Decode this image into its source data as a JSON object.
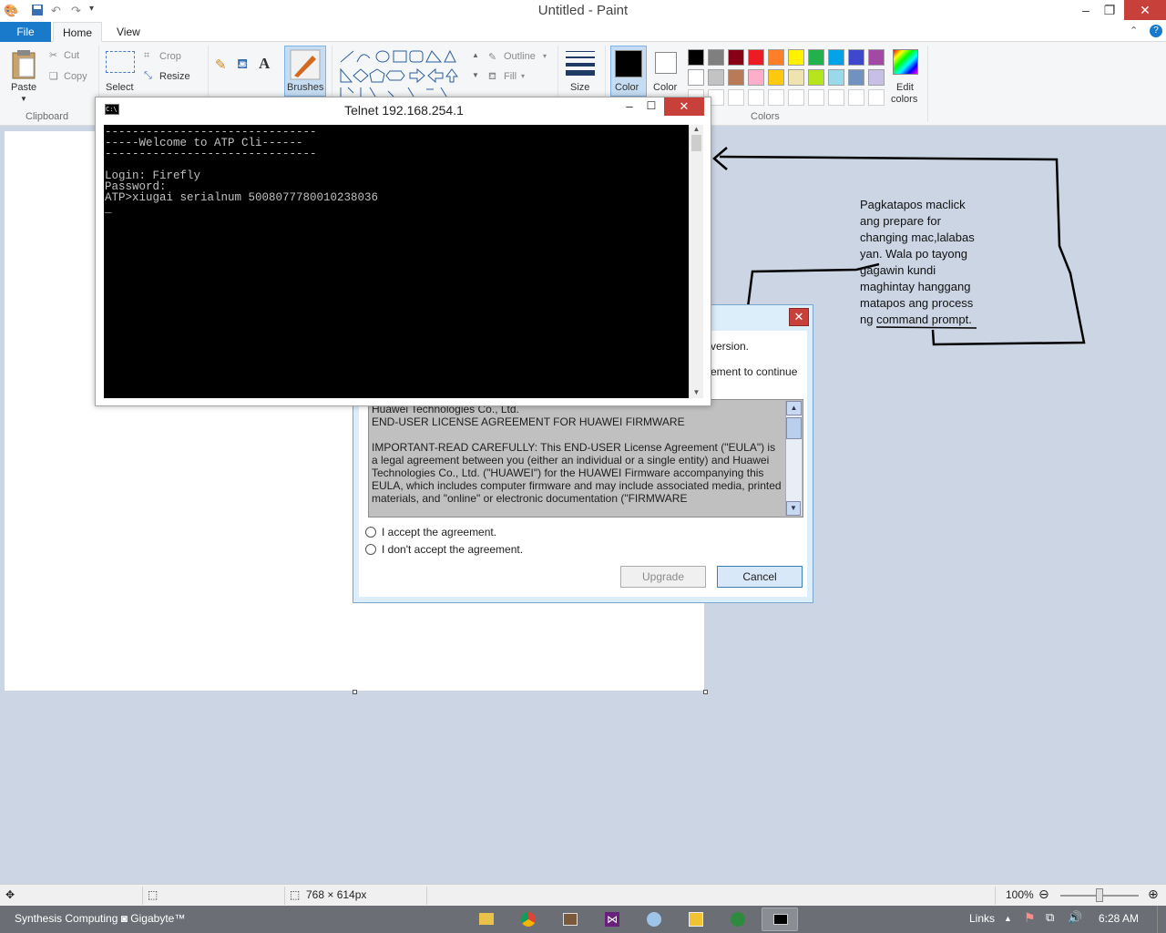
{
  "window": {
    "title": "Untitled - Paint"
  },
  "tabs": {
    "file": "File",
    "home": "Home",
    "view": "View"
  },
  "ribbon": {
    "paste": "Paste",
    "cut": "Cut",
    "copy": "Copy",
    "clipboard_group": "Clipboard",
    "crop": "Crop",
    "resize": "Resize",
    "select": "Select",
    "brushes": "Brushes",
    "outline": "Outline",
    "fill": "Fill",
    "size": "Size",
    "color1": "Color",
    "color2": "Color",
    "edit_colors_1": "Edit",
    "edit_colors_2": "colors",
    "colors_group": "Colors",
    "palette_row1": [
      "#000000",
      "#7f7f7f",
      "#880015",
      "#ed1c24",
      "#ff7f27",
      "#fff200",
      "#22b14c",
      "#00a2e8",
      "#3f48cc",
      "#a349a4"
    ],
    "palette_row2": [
      "#ffffff",
      "#c3c3c3",
      "#b97a57",
      "#ffaec9",
      "#ffc90e",
      "#efe4b0",
      "#b5e61d",
      "#99d9ea",
      "#7092be",
      "#c8bfe7"
    ]
  },
  "telnet": {
    "title": "Telnet 192.168.254.1",
    "lines": [
      "-------------------------------",
      "-----Welcome to ATP Cli------",
      "-------------------------------",
      "",
      "Login: Firefly",
      "Password:",
      "ATP>xiugai serialnum 5008077780010238036",
      "_"
    ]
  },
  "dialog": {
    "partial_line1": "version.",
    "partial_line2": "ement to continue",
    "eula_company": "Huawei Technologies Co., Ltd.",
    "eula_title": "END-USER LICENSE AGREEMENT FOR HUAWEI FIRMWARE",
    "eula_body": "IMPORTANT-READ CAREFULLY: This END-USER License Agreement (\"EULA\") is a legal agreement between you (either an individual or a single entity) and Huawei Technologies Co., Ltd. (\"HUAWEI\") for the HUAWEI Firmware accompanying this EULA, which includes computer firmware and may include associated media, printed materials, and \"online\" or electronic documentation (\"FIRMWARE",
    "accept": "I accept the agreement.",
    "decline": "I don't accept the agreement.",
    "upgrade": "Upgrade",
    "cancel": "Cancel"
  },
  "annotation": {
    "text": "Pagkatapos maclick ang prepare for changing mac,lalabas yan. Wala po tayong gagawin kundi maghintay hanggang matapos ang process ng command prompt."
  },
  "statusbar": {
    "dimensions": "768 × 614px",
    "zoom": "100%"
  },
  "taskbar": {
    "left_label": "Synthesis Computing ◙ Gigabyte™",
    "links": "Links",
    "time": "6:28 AM"
  },
  "colors": {
    "accent": "#1979ca",
    "close": "#c7413a",
    "taskbar": "#6b6e74"
  }
}
